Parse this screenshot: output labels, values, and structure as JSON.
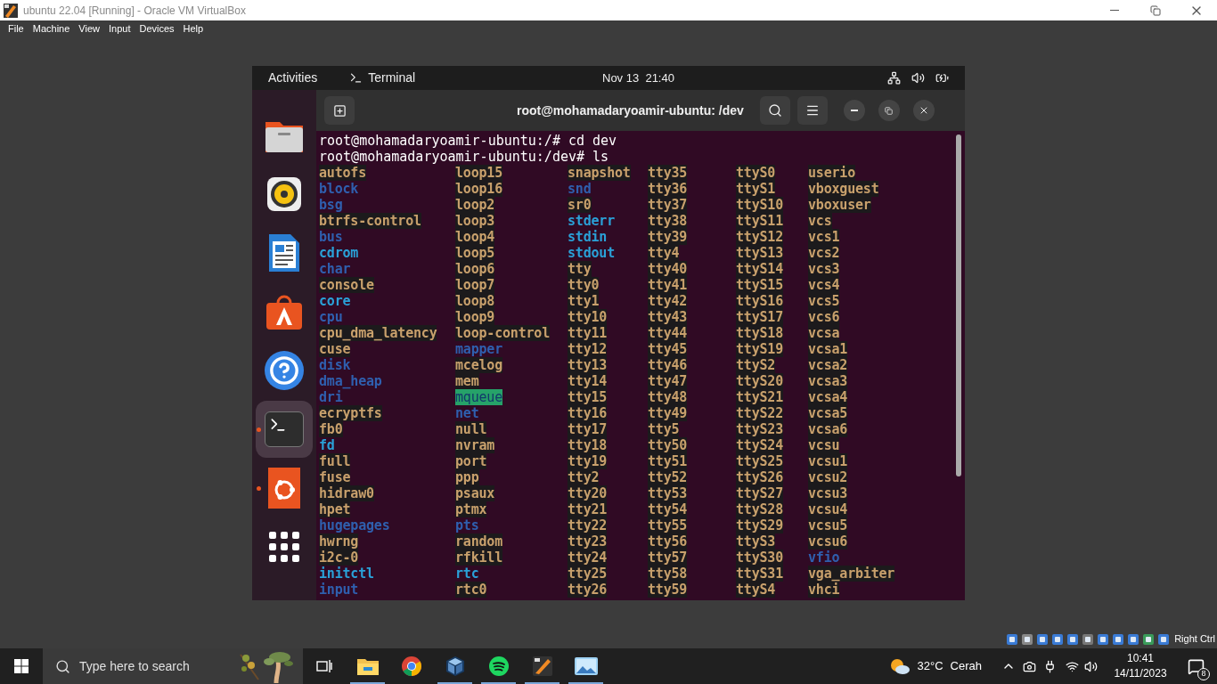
{
  "vbox": {
    "title": "ubuntu 22.04 [Running] - Oracle VM VirtualBox",
    "menu": [
      "File",
      "Machine",
      "View",
      "Input",
      "Devices",
      "Help"
    ],
    "host_key": "Right Ctrl"
  },
  "top_bar": {
    "activities": "Activities",
    "app": "Terminal",
    "clock": "Nov 13  21:40"
  },
  "dock": [
    {
      "kind": "files",
      "running": false,
      "selected": false
    },
    {
      "kind": "music",
      "running": false,
      "selected": false
    },
    {
      "kind": "writer",
      "running": false,
      "selected": false
    },
    {
      "kind": "store",
      "running": false,
      "selected": false
    },
    {
      "kind": "help",
      "running": false,
      "selected": false
    },
    {
      "kind": "terminal",
      "running": true,
      "selected": true
    },
    {
      "kind": "ubuntu",
      "running": true,
      "selected": false
    },
    {
      "kind": "apps",
      "running": false,
      "selected": false
    }
  ],
  "terminal": {
    "title": "root@mohamadaryoamir-ubuntu: /dev",
    "lines": [
      "root@mohamadaryoamir-ubuntu:/# cd dev",
      "root@mohamadaryoamir-ubuntu:/dev# ls"
    ],
    "columns": [
      [
        {
          "name": "autofs",
          "kind": "device"
        },
        {
          "name": "block",
          "kind": "dir"
        },
        {
          "name": "bsg",
          "kind": "dir"
        },
        {
          "name": "btrfs-control",
          "kind": "device"
        },
        {
          "name": "bus",
          "kind": "dir"
        },
        {
          "name": "cdrom",
          "kind": "link"
        },
        {
          "name": "char",
          "kind": "dir"
        },
        {
          "name": "console",
          "kind": "device"
        },
        {
          "name": "core",
          "kind": "link"
        },
        {
          "name": "cpu",
          "kind": "dir"
        },
        {
          "name": "cpu_dma_latency",
          "kind": "device"
        },
        {
          "name": "cuse",
          "kind": "device"
        },
        {
          "name": "disk",
          "kind": "dir"
        },
        {
          "name": "dma_heap",
          "kind": "dir"
        },
        {
          "name": "dri",
          "kind": "dir"
        },
        {
          "name": "ecryptfs",
          "kind": "device"
        },
        {
          "name": "fb0",
          "kind": "device"
        },
        {
          "name": "fd",
          "kind": "link"
        },
        {
          "name": "full",
          "kind": "device"
        },
        {
          "name": "fuse",
          "kind": "device"
        },
        {
          "name": "hidraw0",
          "kind": "device"
        },
        {
          "name": "hpet",
          "kind": "device"
        },
        {
          "name": "hugepages",
          "kind": "dir"
        },
        {
          "name": "hwrng",
          "kind": "device"
        },
        {
          "name": "i2c-0",
          "kind": "device"
        },
        {
          "name": "initctl",
          "kind": "link"
        },
        {
          "name": "input",
          "kind": "dir"
        }
      ],
      [
        {
          "name": "loop15",
          "kind": "device"
        },
        {
          "name": "loop16",
          "kind": "device"
        },
        {
          "name": "loop2",
          "kind": "device"
        },
        {
          "name": "loop3",
          "kind": "device"
        },
        {
          "name": "loop4",
          "kind": "device"
        },
        {
          "name": "loop5",
          "kind": "device"
        },
        {
          "name": "loop6",
          "kind": "device"
        },
        {
          "name": "loop7",
          "kind": "device"
        },
        {
          "name": "loop8",
          "kind": "device"
        },
        {
          "name": "loop9",
          "kind": "device"
        },
        {
          "name": "loop-control",
          "kind": "device"
        },
        {
          "name": "mapper",
          "kind": "dir"
        },
        {
          "name": "mcelog",
          "kind": "device"
        },
        {
          "name": "mem",
          "kind": "device"
        },
        {
          "name": "mqueue",
          "kind": "sticky"
        },
        {
          "name": "net",
          "kind": "dir"
        },
        {
          "name": "null",
          "kind": "device"
        },
        {
          "name": "nvram",
          "kind": "device"
        },
        {
          "name": "port",
          "kind": "device"
        },
        {
          "name": "ppp",
          "kind": "device"
        },
        {
          "name": "psaux",
          "kind": "device"
        },
        {
          "name": "ptmx",
          "kind": "device"
        },
        {
          "name": "pts",
          "kind": "dir"
        },
        {
          "name": "random",
          "kind": "device"
        },
        {
          "name": "rfkill",
          "kind": "device"
        },
        {
          "name": "rtc",
          "kind": "link"
        },
        {
          "name": "rtc0",
          "kind": "device"
        }
      ],
      [
        {
          "name": "snapshot",
          "kind": "device"
        },
        {
          "name": "snd",
          "kind": "dir"
        },
        {
          "name": "sr0",
          "kind": "device"
        },
        {
          "name": "stderr",
          "kind": "link"
        },
        {
          "name": "stdin",
          "kind": "link"
        },
        {
          "name": "stdout",
          "kind": "link"
        },
        {
          "name": "tty",
          "kind": "device"
        },
        {
          "name": "tty0",
          "kind": "device"
        },
        {
          "name": "tty1",
          "kind": "device"
        },
        {
          "name": "tty10",
          "kind": "device"
        },
        {
          "name": "tty11",
          "kind": "device"
        },
        {
          "name": "tty12",
          "kind": "device"
        },
        {
          "name": "tty13",
          "kind": "device"
        },
        {
          "name": "tty14",
          "kind": "device"
        },
        {
          "name": "tty15",
          "kind": "device"
        },
        {
          "name": "tty16",
          "kind": "device"
        },
        {
          "name": "tty17",
          "kind": "device"
        },
        {
          "name": "tty18",
          "kind": "device"
        },
        {
          "name": "tty19",
          "kind": "device"
        },
        {
          "name": "tty2",
          "kind": "device"
        },
        {
          "name": "tty20",
          "kind": "device"
        },
        {
          "name": "tty21",
          "kind": "device"
        },
        {
          "name": "tty22",
          "kind": "device"
        },
        {
          "name": "tty23",
          "kind": "device"
        },
        {
          "name": "tty24",
          "kind": "device"
        },
        {
          "name": "tty25",
          "kind": "device"
        },
        {
          "name": "tty26",
          "kind": "device"
        }
      ],
      [
        {
          "name": "tty35",
          "kind": "device"
        },
        {
          "name": "tty36",
          "kind": "device"
        },
        {
          "name": "tty37",
          "kind": "device"
        },
        {
          "name": "tty38",
          "kind": "device"
        },
        {
          "name": "tty39",
          "kind": "device"
        },
        {
          "name": "tty4",
          "kind": "device"
        },
        {
          "name": "tty40",
          "kind": "device"
        },
        {
          "name": "tty41",
          "kind": "device"
        },
        {
          "name": "tty42",
          "kind": "device"
        },
        {
          "name": "tty43",
          "kind": "device"
        },
        {
          "name": "tty44",
          "kind": "device"
        },
        {
          "name": "tty45",
          "kind": "device"
        },
        {
          "name": "tty46",
          "kind": "device"
        },
        {
          "name": "tty47",
          "kind": "device"
        },
        {
          "name": "tty48",
          "kind": "device"
        },
        {
          "name": "tty49",
          "kind": "device"
        },
        {
          "name": "tty5",
          "kind": "device"
        },
        {
          "name": "tty50",
          "kind": "device"
        },
        {
          "name": "tty51",
          "kind": "device"
        },
        {
          "name": "tty52",
          "kind": "device"
        },
        {
          "name": "tty53",
          "kind": "device"
        },
        {
          "name": "tty54",
          "kind": "device"
        },
        {
          "name": "tty55",
          "kind": "device"
        },
        {
          "name": "tty56",
          "kind": "device"
        },
        {
          "name": "tty57",
          "kind": "device"
        },
        {
          "name": "tty58",
          "kind": "device"
        },
        {
          "name": "tty59",
          "kind": "device"
        }
      ],
      [
        {
          "name": "ttyS0",
          "kind": "device"
        },
        {
          "name": "ttyS1",
          "kind": "device"
        },
        {
          "name": "ttyS10",
          "kind": "device"
        },
        {
          "name": "ttyS11",
          "kind": "device"
        },
        {
          "name": "ttyS12",
          "kind": "device"
        },
        {
          "name": "ttyS13",
          "kind": "device"
        },
        {
          "name": "ttyS14",
          "kind": "device"
        },
        {
          "name": "ttyS15",
          "kind": "device"
        },
        {
          "name": "ttyS16",
          "kind": "device"
        },
        {
          "name": "ttyS17",
          "kind": "device"
        },
        {
          "name": "ttyS18",
          "kind": "device"
        },
        {
          "name": "ttyS19",
          "kind": "device"
        },
        {
          "name": "ttyS2",
          "kind": "device"
        },
        {
          "name": "ttyS20",
          "kind": "device"
        },
        {
          "name": "ttyS21",
          "kind": "device"
        },
        {
          "name": "ttyS22",
          "kind": "device"
        },
        {
          "name": "ttyS23",
          "kind": "device"
        },
        {
          "name": "ttyS24",
          "kind": "device"
        },
        {
          "name": "ttyS25",
          "kind": "device"
        },
        {
          "name": "ttyS26",
          "kind": "device"
        },
        {
          "name": "ttyS27",
          "kind": "device"
        },
        {
          "name": "ttyS28",
          "kind": "device"
        },
        {
          "name": "ttyS29",
          "kind": "device"
        },
        {
          "name": "ttyS3",
          "kind": "device"
        },
        {
          "name": "ttyS30",
          "kind": "device"
        },
        {
          "name": "ttyS31",
          "kind": "device"
        },
        {
          "name": "ttyS4",
          "kind": "device"
        }
      ],
      [
        {
          "name": "userio",
          "kind": "device"
        },
        {
          "name": "vboxguest",
          "kind": "device"
        },
        {
          "name": "vboxuser",
          "kind": "device"
        },
        {
          "name": "vcs",
          "kind": "device"
        },
        {
          "name": "vcs1",
          "kind": "device"
        },
        {
          "name": "vcs2",
          "kind": "device"
        },
        {
          "name": "vcs3",
          "kind": "device"
        },
        {
          "name": "vcs4",
          "kind": "device"
        },
        {
          "name": "vcs5",
          "kind": "device"
        },
        {
          "name": "vcs6",
          "kind": "device"
        },
        {
          "name": "vcsa",
          "kind": "device"
        },
        {
          "name": "vcsa1",
          "kind": "device"
        },
        {
          "name": "vcsa2",
          "kind": "device"
        },
        {
          "name": "vcsa3",
          "kind": "device"
        },
        {
          "name": "vcsa4",
          "kind": "device"
        },
        {
          "name": "vcsa5",
          "kind": "device"
        },
        {
          "name": "vcsa6",
          "kind": "device"
        },
        {
          "name": "vcsu",
          "kind": "device"
        },
        {
          "name": "vcsu1",
          "kind": "device"
        },
        {
          "name": "vcsu2",
          "kind": "device"
        },
        {
          "name": "vcsu3",
          "kind": "device"
        },
        {
          "name": "vcsu4",
          "kind": "device"
        },
        {
          "name": "vcsu5",
          "kind": "device"
        },
        {
          "name": "vcsu6",
          "kind": "device"
        },
        {
          "name": "vfio",
          "kind": "dir"
        },
        {
          "name": "vga_arbiter",
          "kind": "device"
        },
        {
          "name": "vhci",
          "kind": "device"
        }
      ]
    ]
  },
  "taskbar": {
    "search_placeholder": "Type here to search",
    "apps": [
      {
        "kind": "explorer",
        "running": true
      },
      {
        "kind": "chrome",
        "running": false
      },
      {
        "kind": "virtualbox",
        "running": true
      },
      {
        "kind": "spotify",
        "running": true
      },
      {
        "kind": "vm",
        "running": true
      },
      {
        "kind": "photos",
        "running": true
      }
    ],
    "temperature": "32°C",
    "weather": "Cerah",
    "time": "10:41",
    "date": "14/11/2023",
    "notifications": "8"
  }
}
